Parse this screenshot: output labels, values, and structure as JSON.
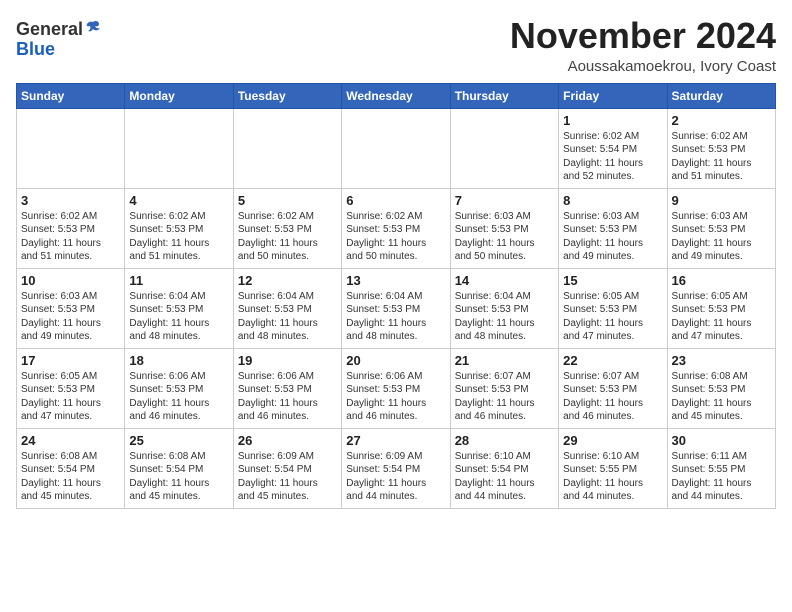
{
  "logo": {
    "general": "General",
    "blue": "Blue"
  },
  "title": {
    "month_year": "November 2024",
    "location": "Aoussakamoekrou, Ivory Coast"
  },
  "days_of_week": [
    "Sunday",
    "Monday",
    "Tuesday",
    "Wednesday",
    "Thursday",
    "Friday",
    "Saturday"
  ],
  "weeks": [
    [
      {
        "day": "",
        "info": ""
      },
      {
        "day": "",
        "info": ""
      },
      {
        "day": "",
        "info": ""
      },
      {
        "day": "",
        "info": ""
      },
      {
        "day": "",
        "info": ""
      },
      {
        "day": "1",
        "info": "Sunrise: 6:02 AM\nSunset: 5:54 PM\nDaylight: 11 hours\nand 52 minutes."
      },
      {
        "day": "2",
        "info": "Sunrise: 6:02 AM\nSunset: 5:53 PM\nDaylight: 11 hours\nand 51 minutes."
      }
    ],
    [
      {
        "day": "3",
        "info": "Sunrise: 6:02 AM\nSunset: 5:53 PM\nDaylight: 11 hours\nand 51 minutes."
      },
      {
        "day": "4",
        "info": "Sunrise: 6:02 AM\nSunset: 5:53 PM\nDaylight: 11 hours\nand 51 minutes."
      },
      {
        "day": "5",
        "info": "Sunrise: 6:02 AM\nSunset: 5:53 PM\nDaylight: 11 hours\nand 50 minutes."
      },
      {
        "day": "6",
        "info": "Sunrise: 6:02 AM\nSunset: 5:53 PM\nDaylight: 11 hours\nand 50 minutes."
      },
      {
        "day": "7",
        "info": "Sunrise: 6:03 AM\nSunset: 5:53 PM\nDaylight: 11 hours\nand 50 minutes."
      },
      {
        "day": "8",
        "info": "Sunrise: 6:03 AM\nSunset: 5:53 PM\nDaylight: 11 hours\nand 49 minutes."
      },
      {
        "day": "9",
        "info": "Sunrise: 6:03 AM\nSunset: 5:53 PM\nDaylight: 11 hours\nand 49 minutes."
      }
    ],
    [
      {
        "day": "10",
        "info": "Sunrise: 6:03 AM\nSunset: 5:53 PM\nDaylight: 11 hours\nand 49 minutes."
      },
      {
        "day": "11",
        "info": "Sunrise: 6:04 AM\nSunset: 5:53 PM\nDaylight: 11 hours\nand 48 minutes."
      },
      {
        "day": "12",
        "info": "Sunrise: 6:04 AM\nSunset: 5:53 PM\nDaylight: 11 hours\nand 48 minutes."
      },
      {
        "day": "13",
        "info": "Sunrise: 6:04 AM\nSunset: 5:53 PM\nDaylight: 11 hours\nand 48 minutes."
      },
      {
        "day": "14",
        "info": "Sunrise: 6:04 AM\nSunset: 5:53 PM\nDaylight: 11 hours\nand 48 minutes."
      },
      {
        "day": "15",
        "info": "Sunrise: 6:05 AM\nSunset: 5:53 PM\nDaylight: 11 hours\nand 47 minutes."
      },
      {
        "day": "16",
        "info": "Sunrise: 6:05 AM\nSunset: 5:53 PM\nDaylight: 11 hours\nand 47 minutes."
      }
    ],
    [
      {
        "day": "17",
        "info": "Sunrise: 6:05 AM\nSunset: 5:53 PM\nDaylight: 11 hours\nand 47 minutes."
      },
      {
        "day": "18",
        "info": "Sunrise: 6:06 AM\nSunset: 5:53 PM\nDaylight: 11 hours\nand 46 minutes."
      },
      {
        "day": "19",
        "info": "Sunrise: 6:06 AM\nSunset: 5:53 PM\nDaylight: 11 hours\nand 46 minutes."
      },
      {
        "day": "20",
        "info": "Sunrise: 6:06 AM\nSunset: 5:53 PM\nDaylight: 11 hours\nand 46 minutes."
      },
      {
        "day": "21",
        "info": "Sunrise: 6:07 AM\nSunset: 5:53 PM\nDaylight: 11 hours\nand 46 minutes."
      },
      {
        "day": "22",
        "info": "Sunrise: 6:07 AM\nSunset: 5:53 PM\nDaylight: 11 hours\nand 46 minutes."
      },
      {
        "day": "23",
        "info": "Sunrise: 6:08 AM\nSunset: 5:53 PM\nDaylight: 11 hours\nand 45 minutes."
      }
    ],
    [
      {
        "day": "24",
        "info": "Sunrise: 6:08 AM\nSunset: 5:54 PM\nDaylight: 11 hours\nand 45 minutes."
      },
      {
        "day": "25",
        "info": "Sunrise: 6:08 AM\nSunset: 5:54 PM\nDaylight: 11 hours\nand 45 minutes."
      },
      {
        "day": "26",
        "info": "Sunrise: 6:09 AM\nSunset: 5:54 PM\nDaylight: 11 hours\nand 45 minutes."
      },
      {
        "day": "27",
        "info": "Sunrise: 6:09 AM\nSunset: 5:54 PM\nDaylight: 11 hours\nand 44 minutes."
      },
      {
        "day": "28",
        "info": "Sunrise: 6:10 AM\nSunset: 5:54 PM\nDaylight: 11 hours\nand 44 minutes."
      },
      {
        "day": "29",
        "info": "Sunrise: 6:10 AM\nSunset: 5:55 PM\nDaylight: 11 hours\nand 44 minutes."
      },
      {
        "day": "30",
        "info": "Sunrise: 6:11 AM\nSunset: 5:55 PM\nDaylight: 11 hours\nand 44 minutes."
      }
    ]
  ]
}
